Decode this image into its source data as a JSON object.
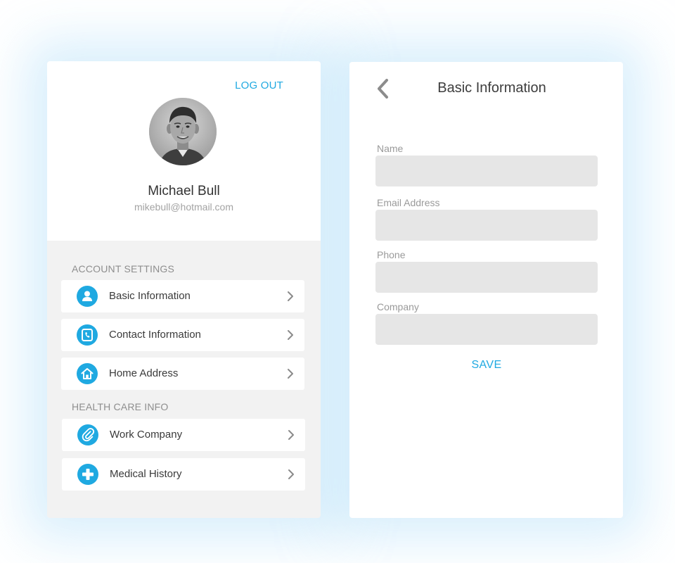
{
  "profile": {
    "logout_label": "LOG OUT",
    "name": "Michael Bull",
    "email": "mikebull@hotmail.com",
    "avatar_icon": "user-photo"
  },
  "account_settings": {
    "title": "ACCOUNT SETTINGS",
    "items": [
      {
        "label": "Basic Information",
        "icon": "user-icon"
      },
      {
        "label": "Contact Information",
        "icon": "phone-icon"
      },
      {
        "label": "Home Address",
        "icon": "home-icon"
      }
    ]
  },
  "health_care": {
    "title": "HEALTH CARE INFO",
    "items": [
      {
        "label": "Work Company",
        "icon": "paperclip-icon"
      },
      {
        "label": "Medical History",
        "icon": "plus-icon"
      }
    ]
  },
  "form": {
    "title": "Basic Information",
    "fields": [
      {
        "label": "Name",
        "value": ""
      },
      {
        "label": "Email Address",
        "value": ""
      },
      {
        "label": "Phone",
        "value": ""
      },
      {
        "label": "Company",
        "value": ""
      }
    ],
    "save_label": "SAVE"
  },
  "colors": {
    "accent": "#1fa9e1",
    "panel_bg": "#f2f2f2",
    "input_bg": "#e6e6e6",
    "text": "#3a3a3a",
    "muted": "#9a9a9a"
  }
}
